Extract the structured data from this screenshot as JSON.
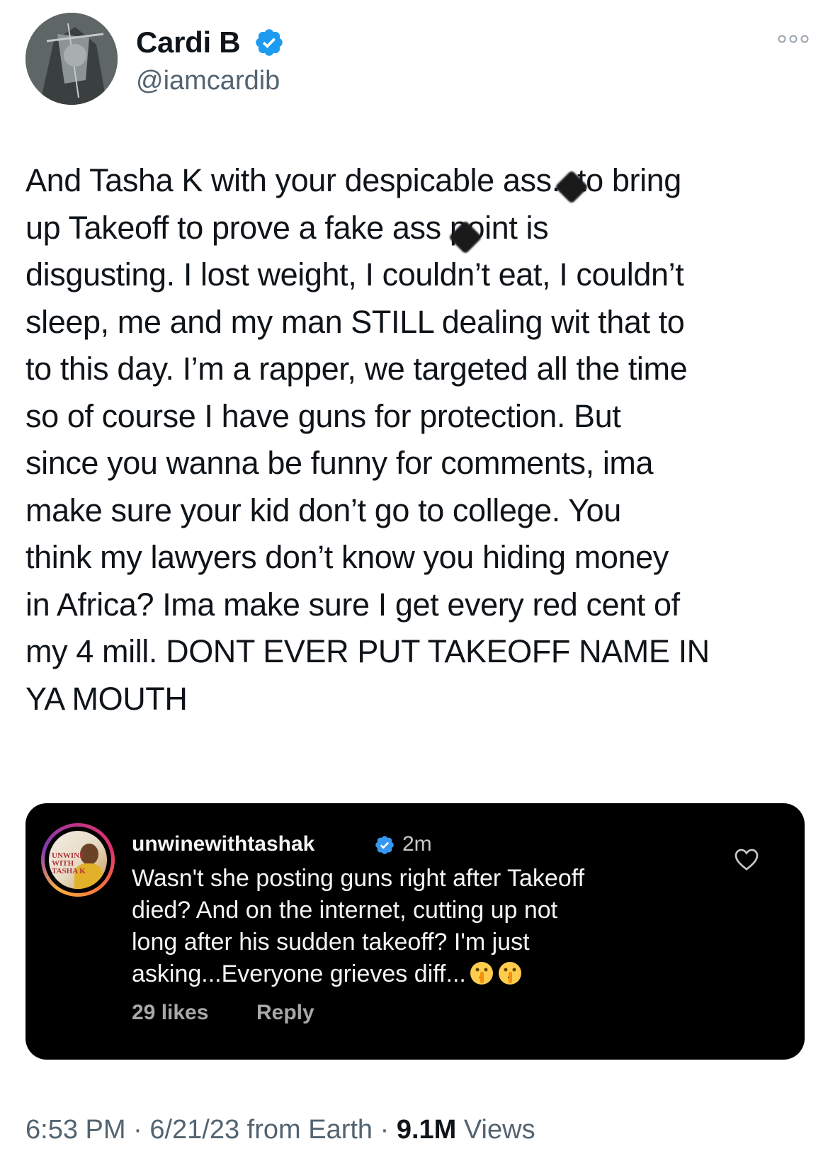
{
  "tweet": {
    "author": {
      "display_name": "Cardi B",
      "handle": "@iamcardib",
      "verified": true,
      "avatar_icon": "profile-photo"
    },
    "more_icon": "more-horizontal-icon",
    "text": "And Tasha K with your despicable ass.. to bring\nup Takeoff to prove a fake ass point is\ndisgusting. I lost weight, I couldn’t eat, I couldn’t\nsleep, me and my man STILL dealing wit that to\nto this day. I’m a rapper, we targeted all the time\nso of course I have guns for protection. But\nsince you wanna be funny for comments, ima\nmake sure your kid don’t go to college. You\nthink my lawyers don’t know you hiding money\nin Africa? Ima make sure I get every red cent of\nmy 4 mill. DONT EVER PUT TAKEOFF NAME IN\nYA MOUTH",
    "timestamp": "6:53 PM",
    "date": "6/21/23",
    "source": "from Earth",
    "views_count": "9.1M",
    "views_label": "Views",
    "separator": "·"
  },
  "embedded_comment": {
    "username": "unwinewithtashak",
    "verified": true,
    "time": "2m",
    "avatar_text": "UNWINE WITH TASHA K",
    "text": "Wasn't she posting guns right after Takeoff\ndied? And on the internet, cutting up not\nlong after his sudden takeoff? I'm just\nasking...Everyone grieves diff...",
    "emoji": "shushing-face-emoji",
    "likes": "29 likes",
    "reply_label": "Reply",
    "heart_icon": "heart-outline-icon"
  },
  "colors": {
    "verified_blue": "#1d9bf0",
    "secondary_text": "#536471",
    "embed_background": "#000000"
  }
}
